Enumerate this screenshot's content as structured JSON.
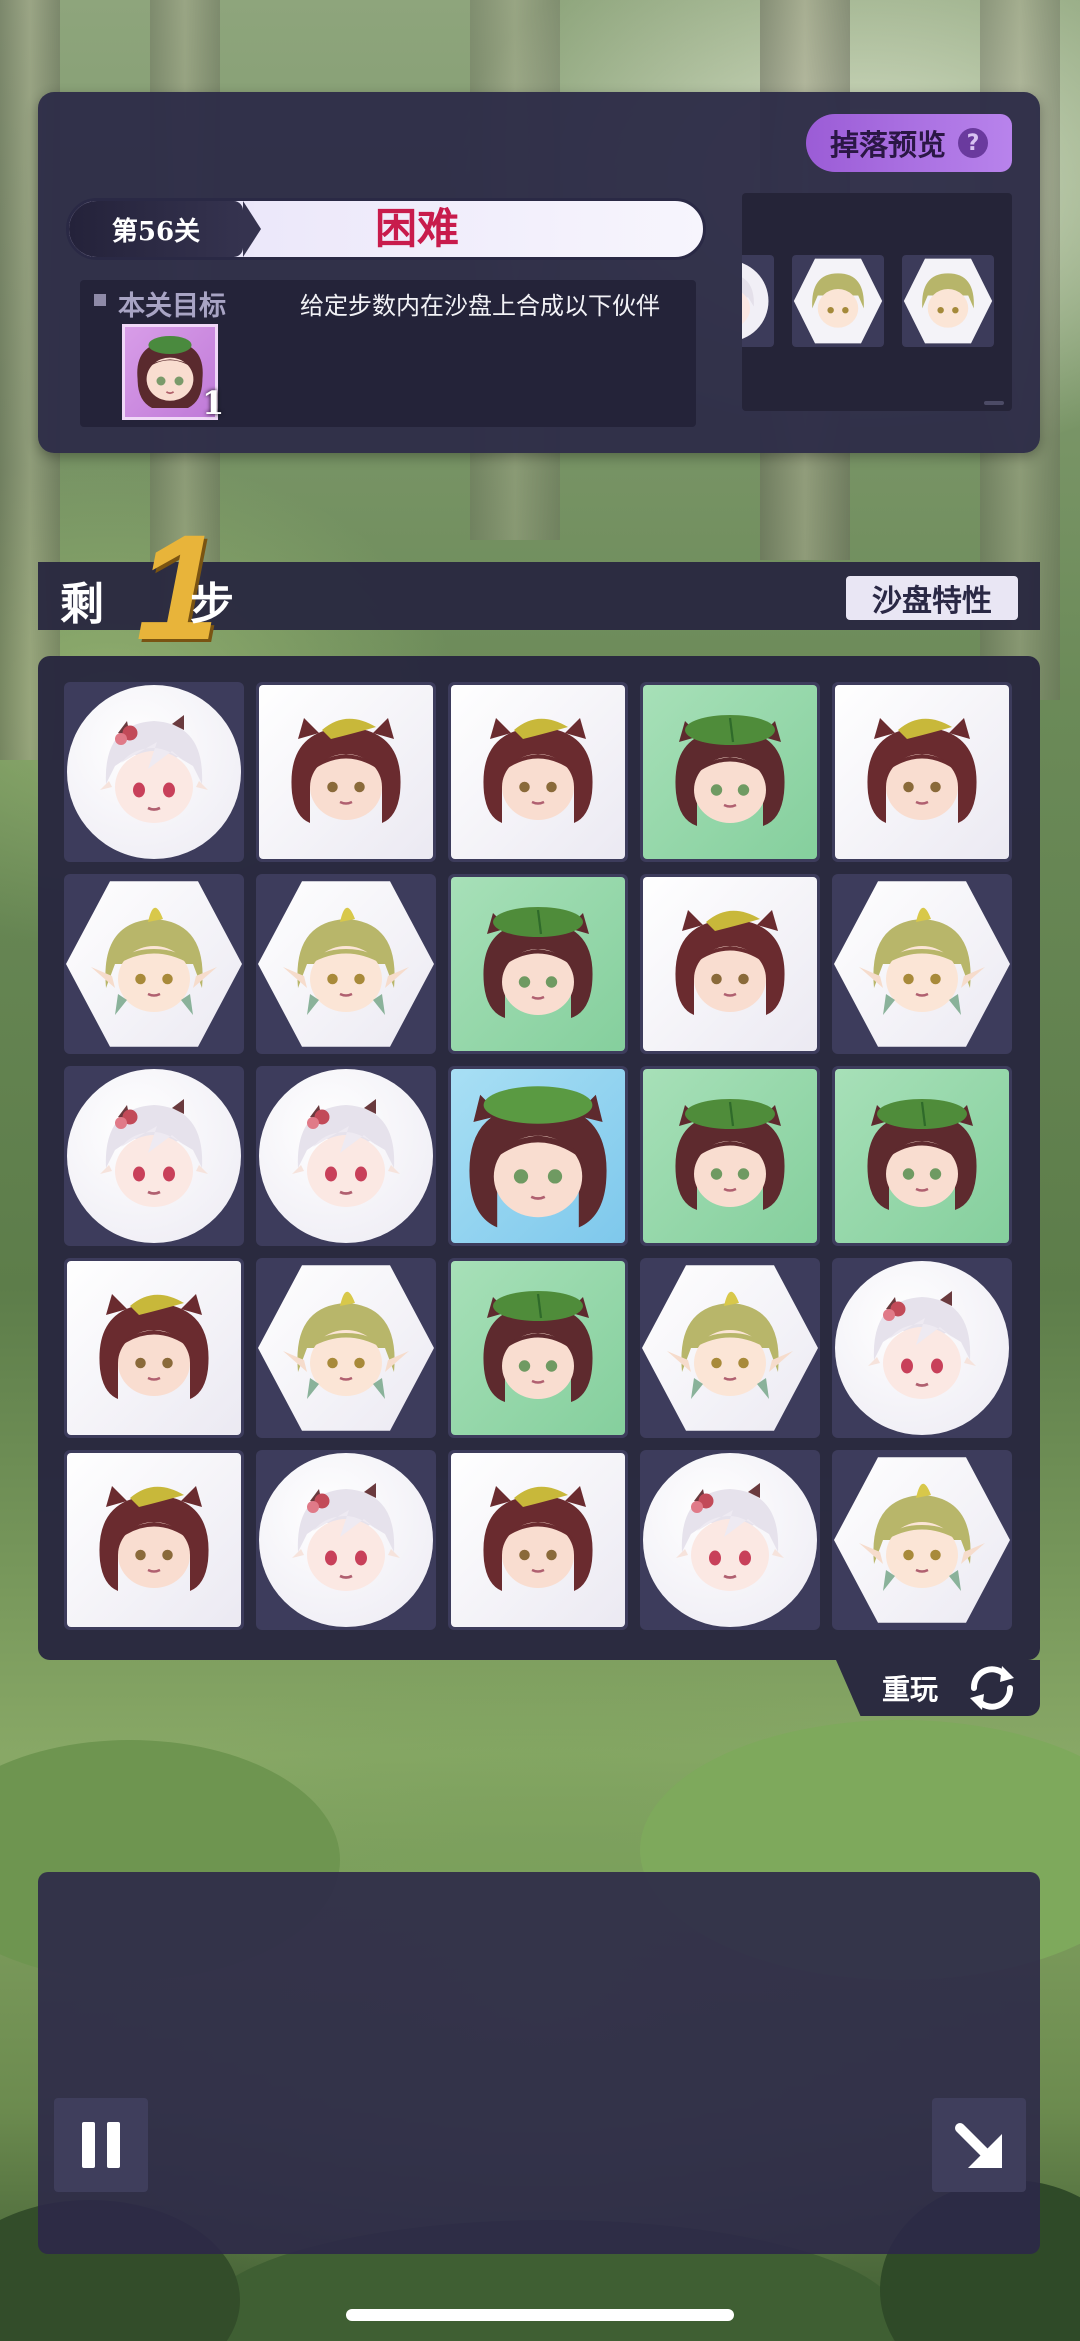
{
  "header": {
    "drop_preview_label": "掉落预览",
    "help_glyph": "?",
    "level_label": "第56关",
    "difficulty": "困难"
  },
  "goal": {
    "title": "本关目标",
    "description": "给定步数内在沙盘上合成以下伙伴",
    "target_character": "leaf-hat-boy",
    "target_count": "1"
  },
  "drop_preview_items": [
    "white-hair-girl",
    "blonde-elf",
    "blonde-elf"
  ],
  "steps": {
    "prefix": "剩",
    "remaining": "1",
    "suffix": "步",
    "board_trait_label": "沙盘特性"
  },
  "board": {
    "rows": [
      [
        {
          "shape": "circle",
          "char": "white-hair-girl"
        },
        {
          "shape": "square",
          "char": "yellow-tuft-boy"
        },
        {
          "shape": "square",
          "char": "yellow-tuft-boy"
        },
        {
          "shape": "green",
          "char": "leaf-hat-boy"
        },
        {
          "shape": "square",
          "char": "yellow-tuft-boy"
        }
      ],
      [
        {
          "shape": "hex",
          "char": "blonde-elf"
        },
        {
          "shape": "hex",
          "char": "blonde-elf"
        },
        {
          "shape": "green",
          "char": "leaf-hat-boy"
        },
        {
          "shape": "square",
          "char": "yellow-tuft-boy"
        },
        {
          "shape": "hex",
          "char": "blonde-elf"
        }
      ],
      [
        {
          "shape": "circle",
          "char": "white-hair-girl"
        },
        {
          "shape": "circle",
          "char": "white-hair-girl"
        },
        {
          "shape": "blue",
          "char": "leaf-hat-boy-big"
        },
        {
          "shape": "green",
          "char": "leaf-hat-boy"
        },
        {
          "shape": "green",
          "char": "leaf-hat-boy"
        }
      ],
      [
        {
          "shape": "square",
          "char": "yellow-tuft-boy"
        },
        {
          "shape": "hex",
          "char": "blonde-elf"
        },
        {
          "shape": "green",
          "char": "leaf-hat-boy"
        },
        {
          "shape": "hex",
          "char": "blonde-elf"
        },
        {
          "shape": "circle",
          "char": "white-hair-girl"
        }
      ],
      [
        {
          "shape": "square",
          "char": "yellow-tuft-boy"
        },
        {
          "shape": "circle",
          "char": "white-hair-girl"
        },
        {
          "shape": "square",
          "char": "yellow-tuft-boy"
        },
        {
          "shape": "circle",
          "char": "white-hair-girl"
        },
        {
          "shape": "hex",
          "char": "blonde-elf"
        }
      ]
    ]
  },
  "controls": {
    "replay_label": "重玩",
    "replay_icon": "refresh-icon",
    "pause_icon": "pause-icon",
    "expand_icon": "expand-arrow-icon"
  },
  "colors": {
    "difficulty": "#c81b4c",
    "steps_number": "#e8b43a",
    "drop_button": "#a86ee0",
    "green_tile": "#96d8ab",
    "blue_tile": "#94d4f0"
  }
}
